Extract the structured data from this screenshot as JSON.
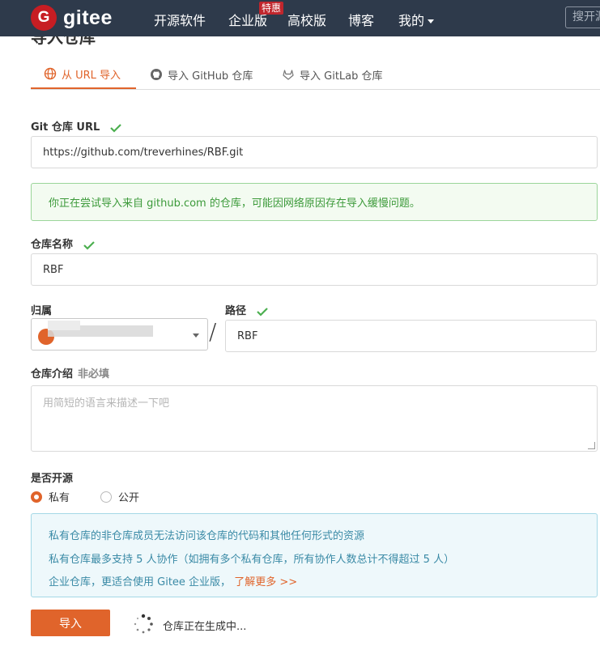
{
  "nav": {
    "logo_letter": "G",
    "logo_text": "gitee",
    "items": [
      "开源软件",
      "企业版",
      "高校版",
      "博客",
      "我的"
    ],
    "enterprise_badge": "特惠",
    "search_placeholder": "搜开源"
  },
  "page": {
    "title": "导入仓库"
  },
  "tabs": [
    {
      "label": "从 URL 导入",
      "icon": "globe-icon",
      "active": true
    },
    {
      "label": "导入 GitHub 仓库",
      "icon": "github-icon",
      "active": false
    },
    {
      "label": "导入 GitLab 仓库",
      "icon": "gitlab-icon",
      "active": false
    }
  ],
  "form": {
    "git_url_label": "Git 仓库 URL",
    "git_url_value": "https://github.com/treverhines/RBF.git",
    "url_notice": "你正在尝试导入来自 github.com 的仓库，可能因网络原因存在导入缓慢问题。",
    "repo_name_label": "仓库名称",
    "repo_name_value": "RBF",
    "owner_label": "归属",
    "path_label": "路径",
    "path_value": "RBF",
    "path_separator": "/",
    "desc_label": "仓库介绍",
    "desc_optional": "非必填",
    "desc_placeholder": "用简短的语言来描述一下吧",
    "visibility_label": "是否开源",
    "private_label": "私有",
    "public_label": "公开",
    "private_notes": [
      "私有仓库的非仓库成员无法访问该仓库的代码和其他任何形式的资源",
      "私有仓库最多支持 5 人协作（如拥有多个私有仓库，所有协作人数总计不得超过 5 人）",
      "企业仓库，更适合使用 Gitee 企业版，"
    ],
    "learn_more": "了解更多 >>",
    "import_button": "导入",
    "status_text": "仓库正在生成中..."
  },
  "colors": {
    "accent": "#e0642b",
    "nav_bg": "#2e3a4b",
    "success": "#4caf50",
    "info": "#3a8aa6"
  }
}
